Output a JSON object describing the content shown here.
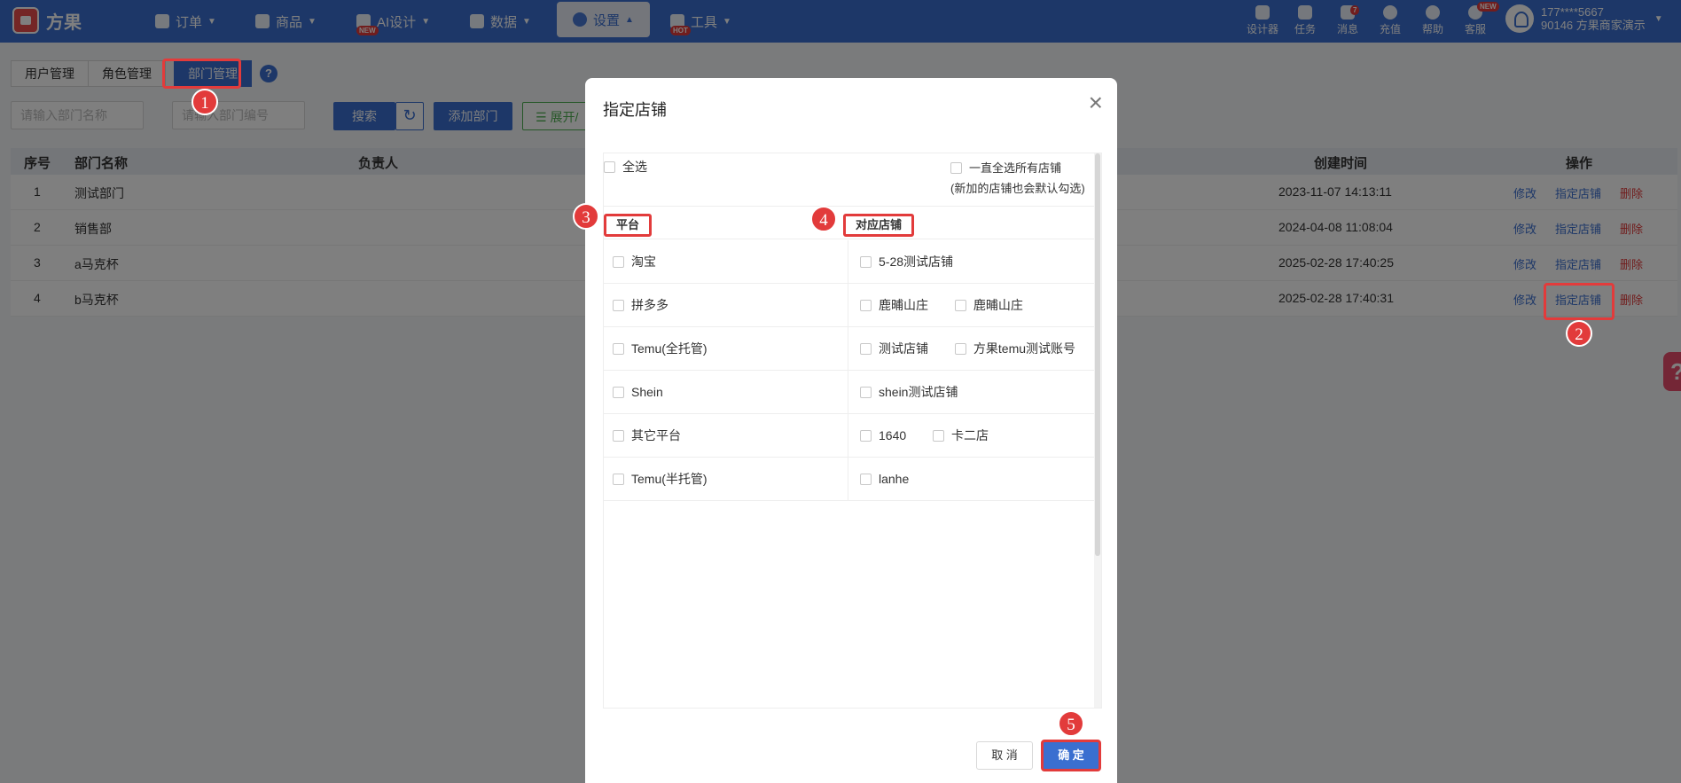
{
  "app": {
    "name": "方果"
  },
  "nav": {
    "items": [
      {
        "label": "订单"
      },
      {
        "label": "商品"
      },
      {
        "label": "AI设计",
        "badge": "NEW"
      },
      {
        "label": "数据"
      },
      {
        "label": "设置"
      },
      {
        "label": "工具",
        "badge": "HOT"
      }
    ],
    "tools": [
      {
        "label": "设计器"
      },
      {
        "label": "任务"
      },
      {
        "label": "消息",
        "badge": "7"
      },
      {
        "label": "充值"
      },
      {
        "label": "帮助"
      },
      {
        "label": "客服",
        "badge": "NEW"
      }
    ],
    "user": {
      "phone": "177****5667",
      "account": "90146 方果商家演示"
    }
  },
  "subtabs": [
    "用户管理",
    "角色管理",
    "部门管理"
  ],
  "filters": {
    "dept_name_placeholder": "请输入部门名称",
    "dept_code_placeholder": "请输入部门编号",
    "search": "搜索",
    "add_dept": "添加部门",
    "expand": "展开/"
  },
  "table": {
    "headers": {
      "no": "序号",
      "name": "部门名称",
      "owner": "负责人",
      "created": "创建时间",
      "ops": "操作"
    },
    "rows": [
      {
        "no": "1",
        "name": "测试部门",
        "created": "2023-11-07 14:13:11"
      },
      {
        "no": "2",
        "name": "销售部",
        "created": "2024-04-08 11:08:04"
      },
      {
        "no": "3",
        "name": "a马克杯",
        "created": "2025-02-28 17:40:25"
      },
      {
        "no": "4",
        "name": "b马克杯",
        "created": "2025-02-28 17:40:31"
      }
    ],
    "ops": {
      "edit": "修改",
      "assign": "指定店铺",
      "delete": "删除"
    }
  },
  "modal": {
    "title": "指定店铺",
    "select_all": "全选",
    "always_select": "一直全选所有店铺",
    "always_note": "(新加的店铺也会默认勾选)",
    "col_platform": "平台",
    "col_shops": "对应店铺",
    "rows": [
      {
        "platform": "淘宝",
        "shops": [
          "5-28测试店铺"
        ]
      },
      {
        "platform": "拼多多",
        "shops": [
          "鹿晡山庄",
          "鹿晡山庄"
        ]
      },
      {
        "platform": "Temu(全托管)",
        "shops": [
          "测试店铺",
          "方果temu测试账号"
        ]
      },
      {
        "platform": "Shein",
        "shops": [
          "shein测试店铺"
        ]
      },
      {
        "platform": "其它平台",
        "shops": [
          "1640",
          "卡二店"
        ]
      },
      {
        "platform": "Temu(半托管)",
        "shops": [
          "lanhe"
        ]
      }
    ],
    "cancel": "取 消",
    "confirm": "确 定"
  },
  "markers": [
    "1",
    "2",
    "3",
    "4",
    "5"
  ],
  "colors": {
    "primary": "#3a6fd0",
    "danger": "#e23b3b",
    "success": "#4caf50"
  }
}
